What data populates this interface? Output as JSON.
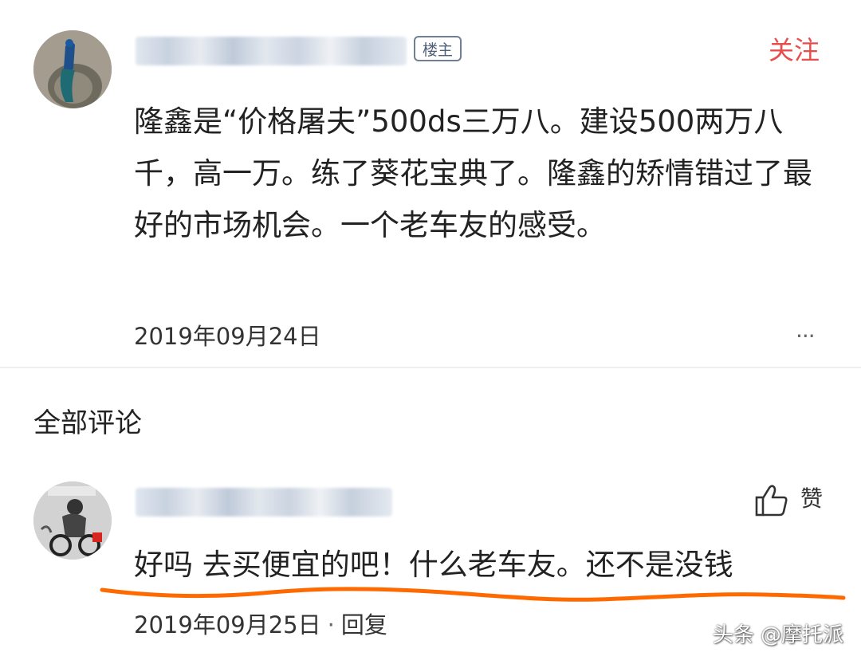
{
  "post": {
    "badge": "楼主",
    "follow_label": "关注",
    "content": "隆鑫是“价格屠夫”500ds三万八。建设500两万八千，高一万。练了葵花宝典了。隆鑫的矫情错过了最好的市场机会。一个老车友的感受。",
    "date": "2019年09月24日",
    "more_label": "···"
  },
  "comments_section": {
    "title": "全部评论"
  },
  "comment": {
    "like_label": "赞",
    "content": "好吗 去买便宜的吧！什么老车友。还不是没钱",
    "date": "2019年09月25日",
    "separator": "·",
    "reply_label": "回复"
  },
  "watermark": "头条 @摩托派",
  "colors": {
    "accent_red": "#e94c4c",
    "underline_orange": "#ff6a00",
    "badge_blue": "#4f6079"
  }
}
